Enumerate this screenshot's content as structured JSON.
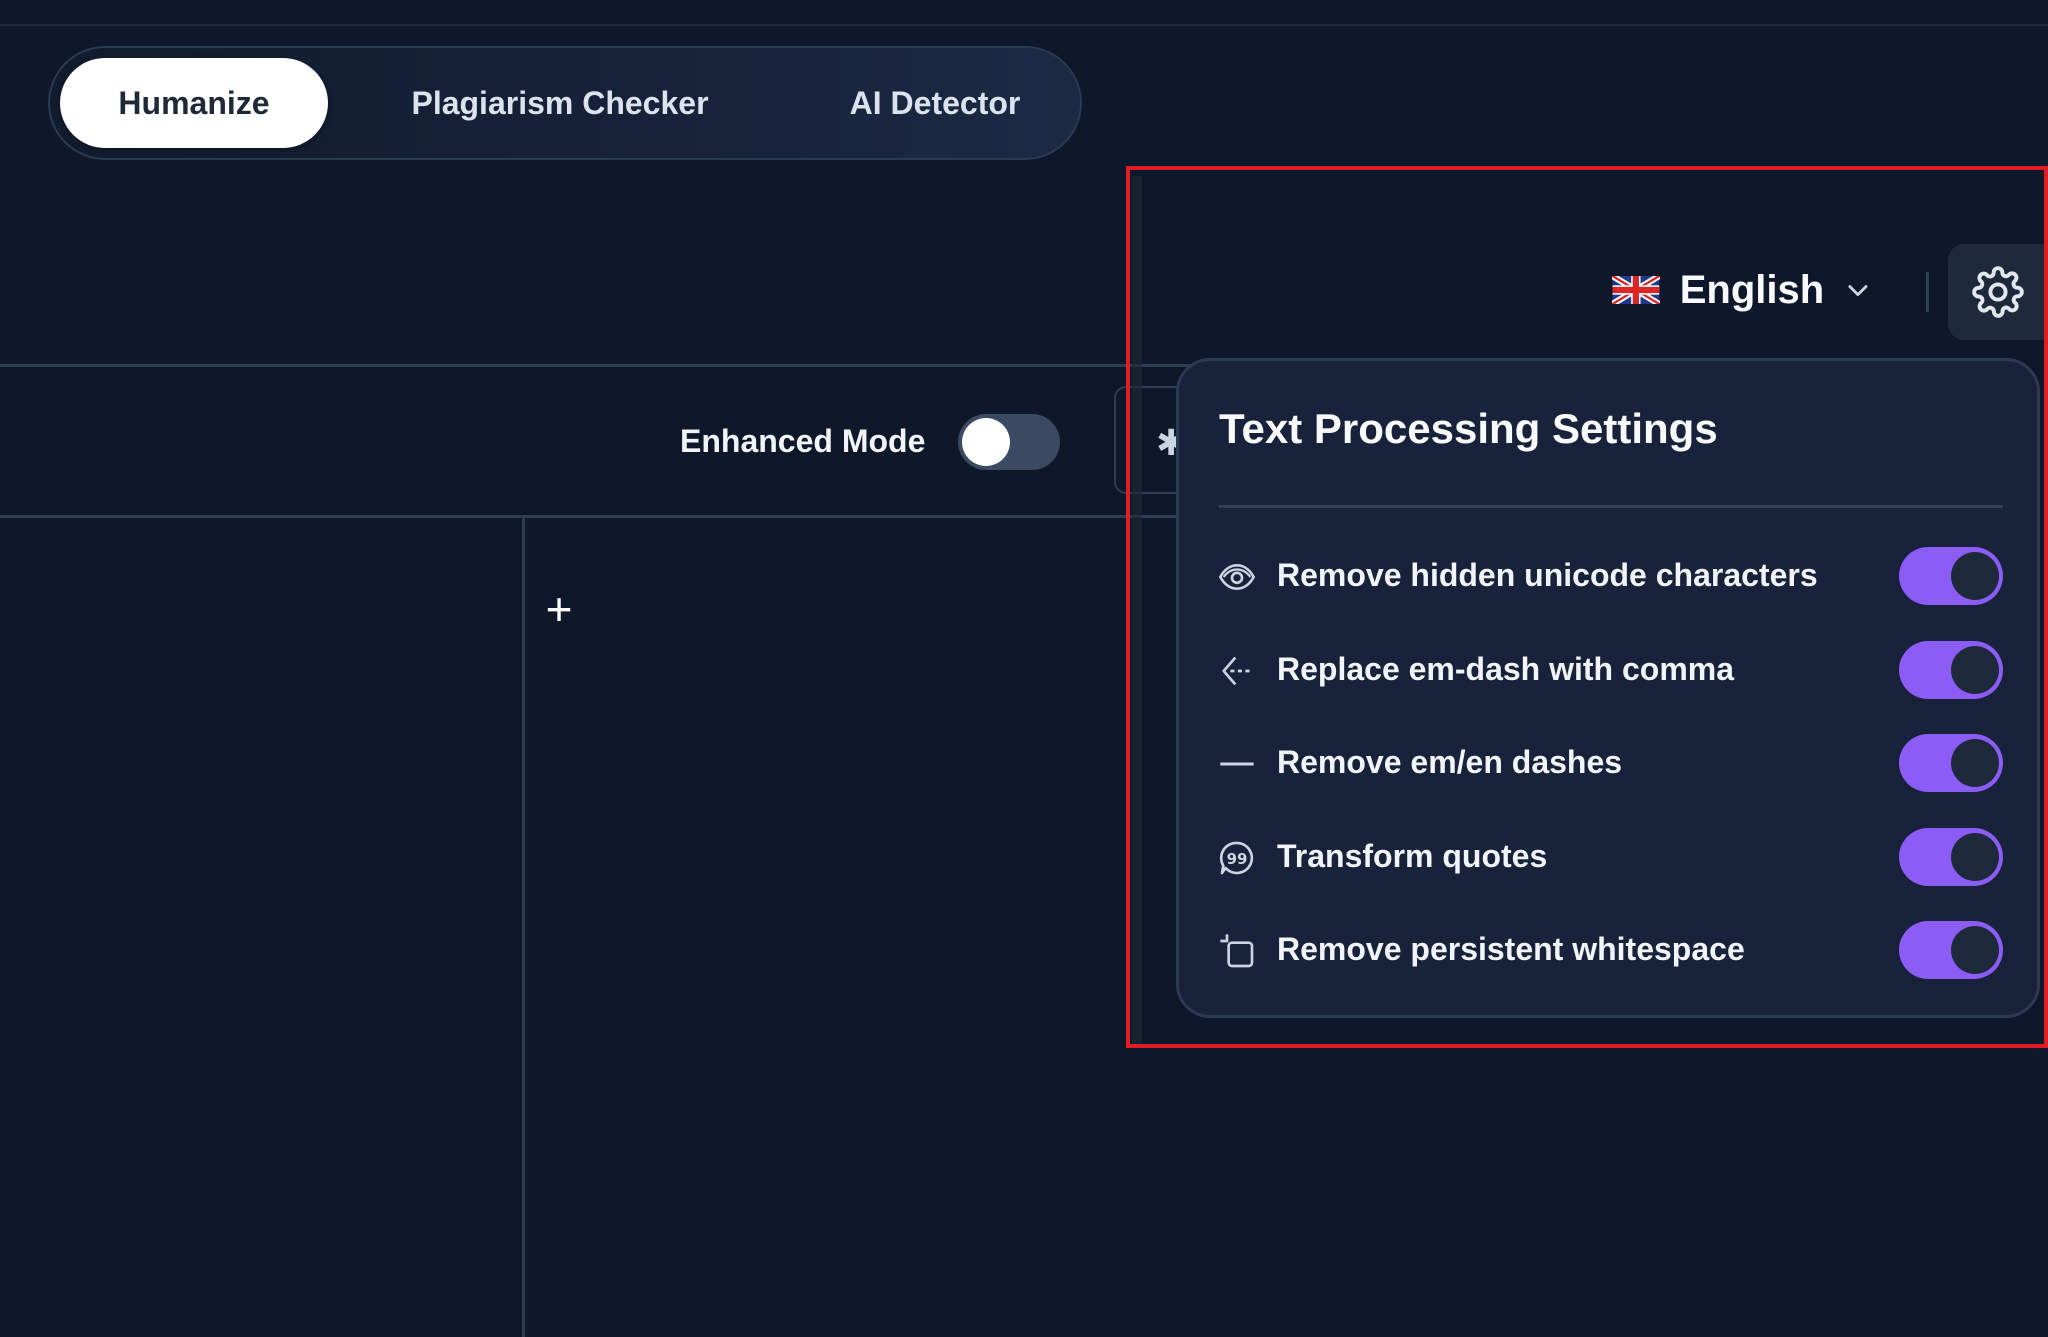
{
  "tabs": {
    "humanize": "Humanize",
    "plagiarism": "Plagiarism Checker",
    "ai_detector": "AI Detector",
    "active": "Humanize"
  },
  "editor": {
    "enhanced_mode_label": "Enhanced Mode",
    "enhanced_mode_on": false,
    "add_icon": "plus-icon"
  },
  "header": {
    "language": "English",
    "flag_icon": "uk-flag-icon",
    "settings_icon": "gear-icon"
  },
  "settings_panel": {
    "title": "Text Processing Settings",
    "items": [
      {
        "label": "Remove hidden unicode characters",
        "icon": "eye-icon",
        "enabled": true
      },
      {
        "label": "Replace em-dash with comma",
        "icon": "replace-arrow-icon",
        "enabled": true
      },
      {
        "label": "Remove em/en dashes",
        "icon": "dash-icon",
        "enabled": true
      },
      {
        "label": "Transform quotes",
        "icon": "quote-bubble-icon",
        "enabled": true
      },
      {
        "label": "Remove persistent whitespace",
        "icon": "crop-square-icon",
        "enabled": true
      }
    ]
  },
  "colors": {
    "background": "#0f172a",
    "panel": "#18223a",
    "toggle_on": "#8b5cf6",
    "highlight": "#e11d24"
  }
}
